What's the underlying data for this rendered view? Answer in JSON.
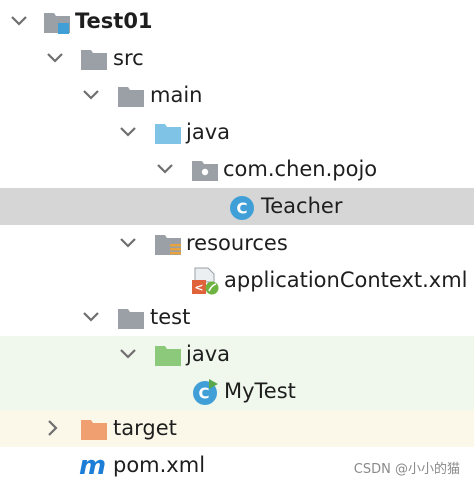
{
  "tree": {
    "project": "Test01",
    "src": "src",
    "main": "main",
    "main_java": "java",
    "package": "com.chen.pojo",
    "teacher": "Teacher",
    "resources": "resources",
    "app_context": "applicationContext.xml",
    "test": "test",
    "test_java": "java",
    "mytest": "MyTest",
    "target": "target",
    "pom": "pom.xml",
    "pom_icon_letter": "m"
  },
  "watermark": "CSDN @小小的猫",
  "icons": {
    "folder": "folder-icon",
    "module": "module-folder-icon",
    "source_root": "source-root-folder-icon",
    "package": "package-icon",
    "class": "java-class-icon",
    "resources_root": "resources-folder-icon",
    "spring_xml": "spring-xml-file-icon",
    "test_root": "test-root-folder-icon",
    "test_class": "test-class-icon",
    "target_folder": "excluded-folder-icon",
    "maven": "maven-icon"
  },
  "colors": {
    "folder_gray": "#9aa0a6",
    "source_blue": "#7fc4e6",
    "test_green": "#8dc97a",
    "target_orange": "#f0a070",
    "class_blue": "#3f9fd6",
    "selection": "#d6d6d6",
    "maven_blue": "#1c7ed6"
  }
}
